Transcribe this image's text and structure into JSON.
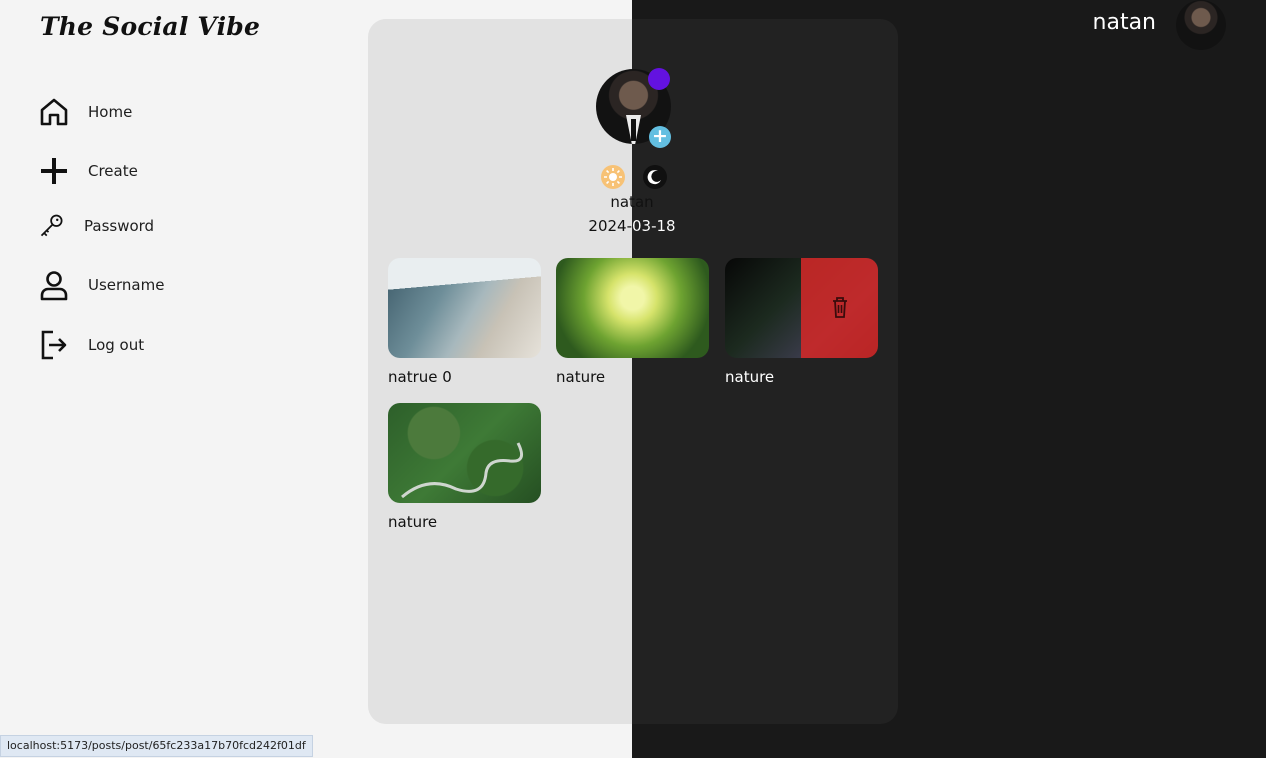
{
  "brand": "The Social Vibe",
  "sidebar": {
    "items": [
      {
        "label": "Home",
        "icon": "home-icon"
      },
      {
        "label": "Create",
        "icon": "plus-icon"
      },
      {
        "label": "Password",
        "icon": "key-icon"
      },
      {
        "label": "Username",
        "icon": "user-icon"
      },
      {
        "label": "Log out",
        "icon": "logout-icon"
      }
    ]
  },
  "topbar": {
    "username": "natan"
  },
  "profile": {
    "name": "natan",
    "date": "2024-03-18",
    "status_color": "#6312e0",
    "add_badge": "+",
    "theme_toggles": [
      "sun-icon",
      "moon-icon"
    ]
  },
  "posts": [
    {
      "caption": "natrue 0"
    },
    {
      "caption": "nature"
    },
    {
      "caption": "nature"
    },
    {
      "caption": "nature"
    }
  ],
  "status_bar": {
    "url": "localhost:5173/posts/post/65fc233a17b70fcd242f01df"
  }
}
